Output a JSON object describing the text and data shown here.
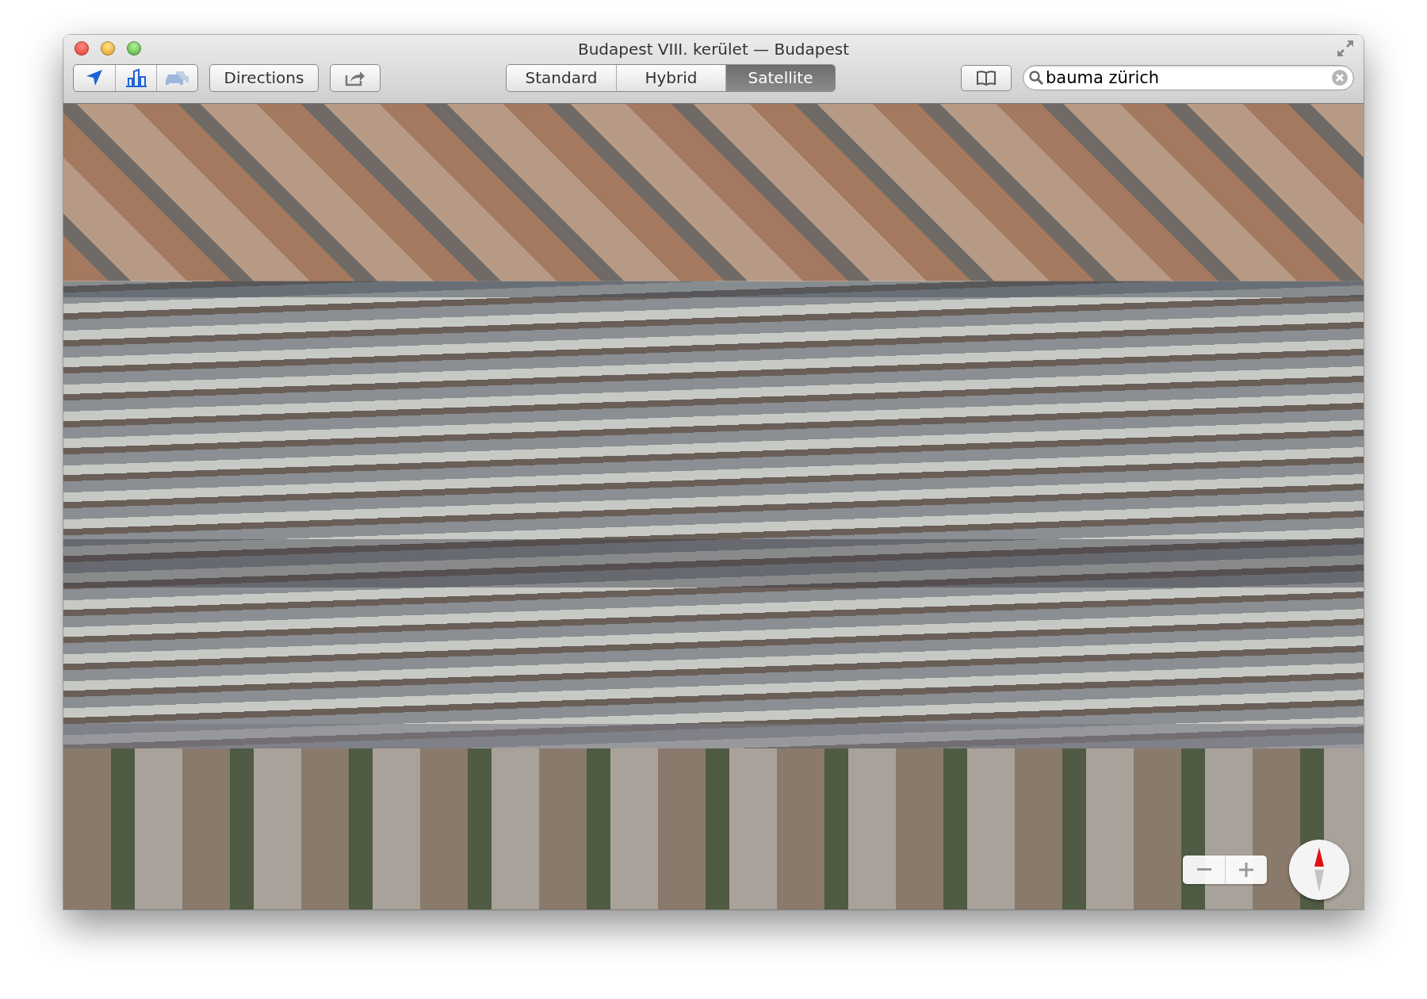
{
  "window": {
    "title": "Budapest VIII. kerület — Budapest"
  },
  "view_buttons": [
    {
      "kind": "location",
      "disabled": false
    },
    {
      "kind": "buildings",
      "disabled": false
    },
    {
      "kind": "traffic",
      "disabled": true
    }
  ],
  "directions_button": "Directions",
  "map_modes": [
    {
      "label": "Standard",
      "selected": false
    },
    {
      "label": "Hybrid",
      "selected": false
    },
    {
      "label": "Satellite",
      "selected": true
    }
  ],
  "search": {
    "value": "bauma zürich"
  }
}
